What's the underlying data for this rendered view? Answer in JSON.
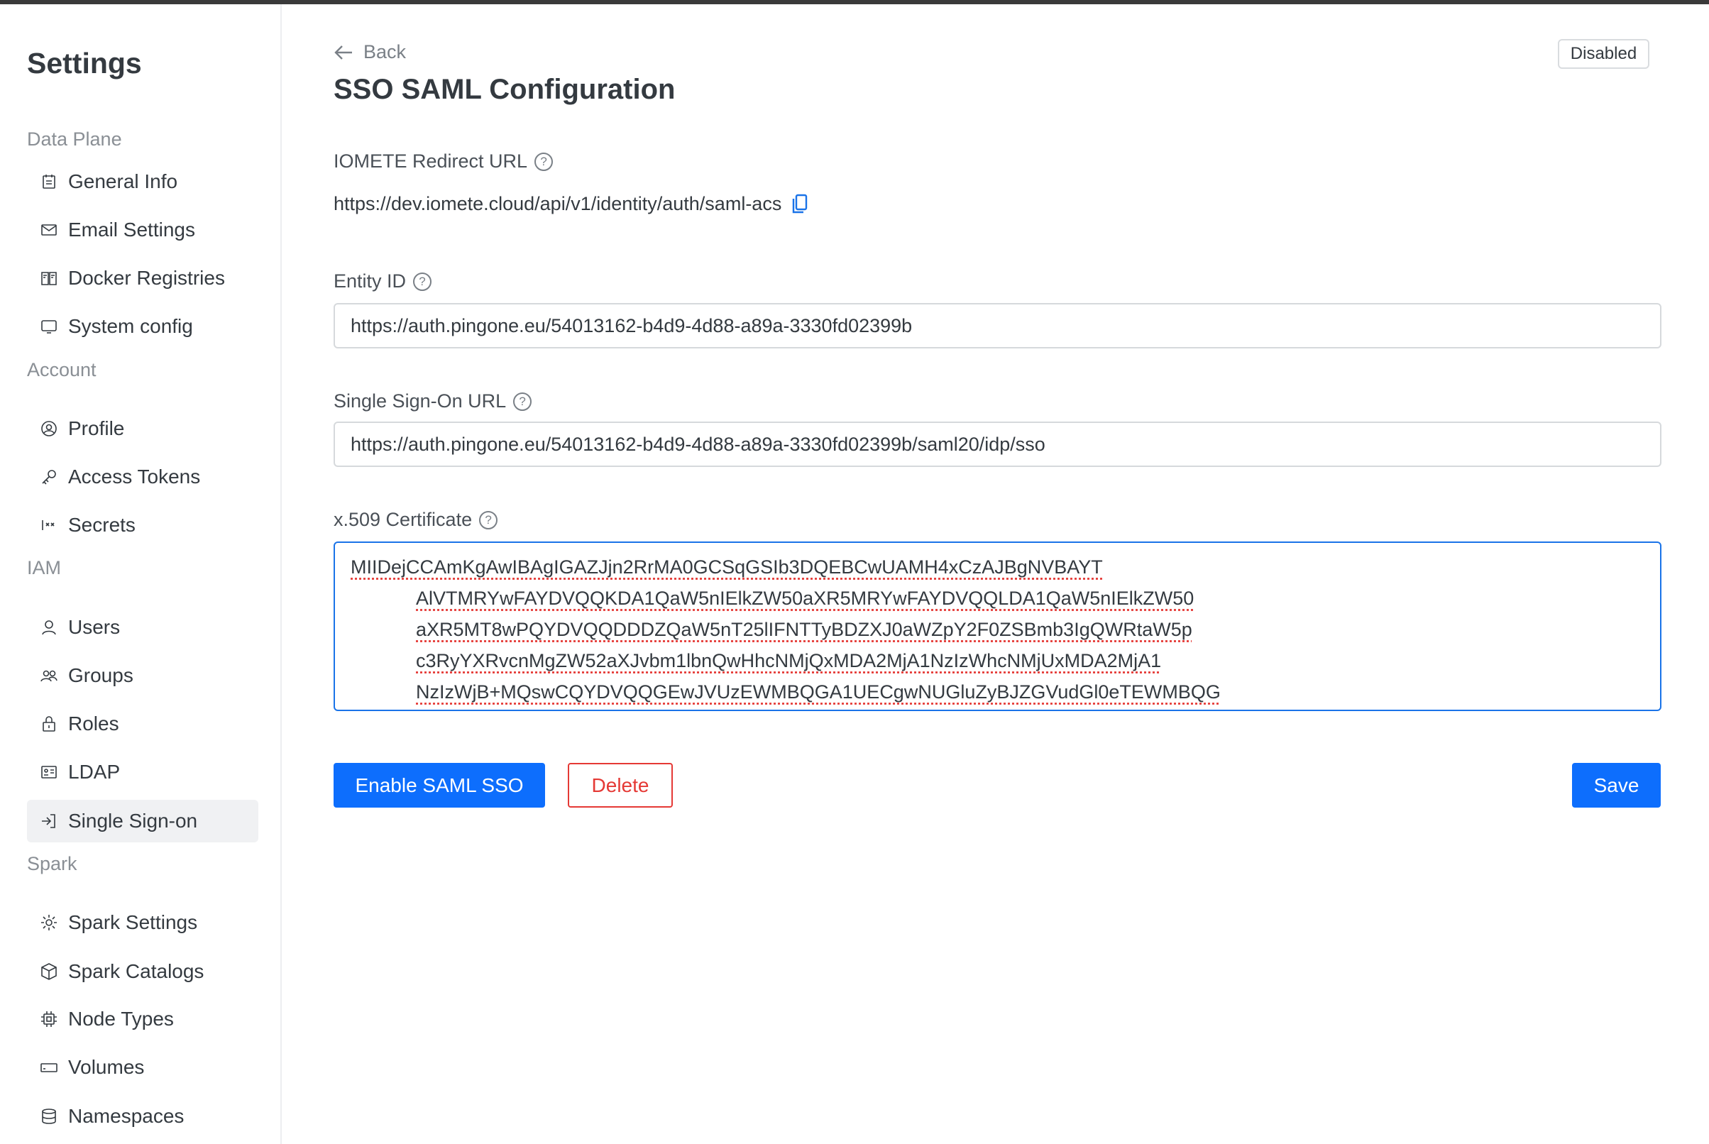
{
  "sidebar": {
    "title": "Settings",
    "sections": [
      {
        "label": "Data Plane",
        "items": [
          {
            "label": "General Info",
            "icon": "calendar-icon"
          },
          {
            "label": "Email Settings",
            "icon": "mail-icon"
          },
          {
            "label": "Docker Registries",
            "icon": "book-icon"
          },
          {
            "label": "System config",
            "icon": "monitor-icon"
          }
        ]
      },
      {
        "label": "Account",
        "items": [
          {
            "label": "Profile",
            "icon": "user-circle-icon"
          },
          {
            "label": "Access Tokens",
            "icon": "key-icon"
          },
          {
            "label": "Secrets",
            "icon": "secret-icon"
          }
        ]
      },
      {
        "label": "IAM",
        "items": [
          {
            "label": "Users",
            "icon": "user-icon"
          },
          {
            "label": "Groups",
            "icon": "users-icon"
          },
          {
            "label": "Roles",
            "icon": "lock-icon"
          },
          {
            "label": "LDAP",
            "icon": "id-card-icon"
          },
          {
            "label": "Single Sign-on",
            "icon": "login-icon",
            "active": true
          }
        ]
      },
      {
        "label": "Spark",
        "items": [
          {
            "label": "Spark Settings",
            "icon": "gear-icon"
          },
          {
            "label": "Spark Catalogs",
            "icon": "cube-icon"
          },
          {
            "label": "Node Types",
            "icon": "chip-icon"
          },
          {
            "label": "Volumes",
            "icon": "drive-icon"
          },
          {
            "label": "Namespaces",
            "icon": "database-icon"
          }
        ]
      }
    ]
  },
  "main": {
    "back": "Back",
    "title": "SSO SAML Configuration",
    "status": "Disabled",
    "redirect_label": "IOMETE Redirect URL",
    "redirect_url": "https://dev.iomete.cloud/api/v1/identity/auth/saml-acs",
    "entity_label": "Entity ID",
    "entity_value": "https://auth.pingone.eu/54013162-b4d9-4d88-a89a-3330fd02399b",
    "sso_label": "Single Sign-On URL",
    "sso_value": "https://auth.pingone.eu/54013162-b4d9-4d88-a89a-3330fd02399b/saml20/idp/sso",
    "cert_label": "x.509 Certificate",
    "cert_lines": [
      "MIIDejCCAmKgAwIBAgIGAZJjn2RrMA0GCSqGSIb3DQEBCwUAMH4xCzAJBgNVBAYT",
      "AlVTMRYwFAYDVQQKDA1QaW5nIElkZW50aXR5MRYwFAYDVQQLDA1QaW5nIElkZW50",
      "aXR5MT8wPQYDVQQDDDZQaW5nT25lIFNTTyBDZXJ0aWZpY2F0ZSBmb3IgQWRtaW5p",
      "c3RyYXRvcnMgZW52aXJvbm1lbnQwHhcNMjQxMDA2MjA1NzIzWhcNMjUxMDA2MjA1",
      "NzIzWjB+MQswCQYDVQQGEwJVUzEWMBQGA1UECgwNUGluZyBJZGVudGl0eTEWMBQG"
    ],
    "enable_label": "Enable SAML SSO",
    "delete_label": "Delete",
    "save_label": "Save",
    "help": "?"
  },
  "colors": {
    "primary": "#0d6efd",
    "danger": "#e53935"
  }
}
